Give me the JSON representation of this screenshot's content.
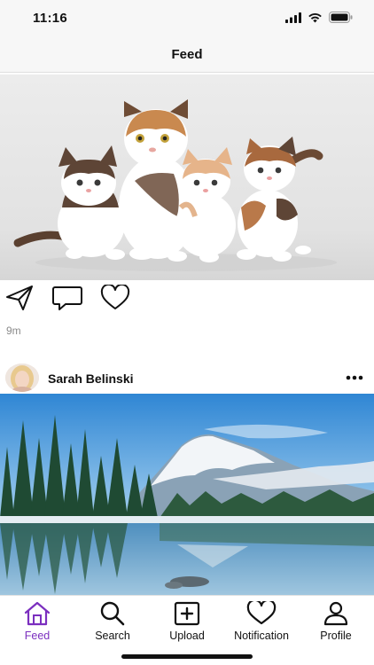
{
  "status_bar": {
    "time": "11:16"
  },
  "nav": {
    "title": "Feed"
  },
  "posts": [
    {
      "image_icon": "kittens-photo",
      "actions": [
        "share-icon",
        "comment-icon",
        "like-icon"
      ],
      "time_ago": "9m"
    },
    {
      "author": "Sarah Belinski",
      "avatar_icon": "avatar",
      "more_icon": "more-icon",
      "image_icon": "mountain-lake-photo"
    }
  ],
  "tabs": [
    {
      "label": "Feed",
      "icon": "home-icon",
      "active": true
    },
    {
      "label": "Search",
      "icon": "search-icon",
      "active": false
    },
    {
      "label": "Upload",
      "icon": "upload-icon",
      "active": false
    },
    {
      "label": "Notification",
      "icon": "heart-icon",
      "active": false
    },
    {
      "label": "Profile",
      "icon": "person-icon",
      "active": false
    }
  ],
  "colors": {
    "accent": "#7b2fbf",
    "text": "#111111",
    "muted": "#8a8a8a",
    "bar_bg": "#f7f7f7"
  }
}
